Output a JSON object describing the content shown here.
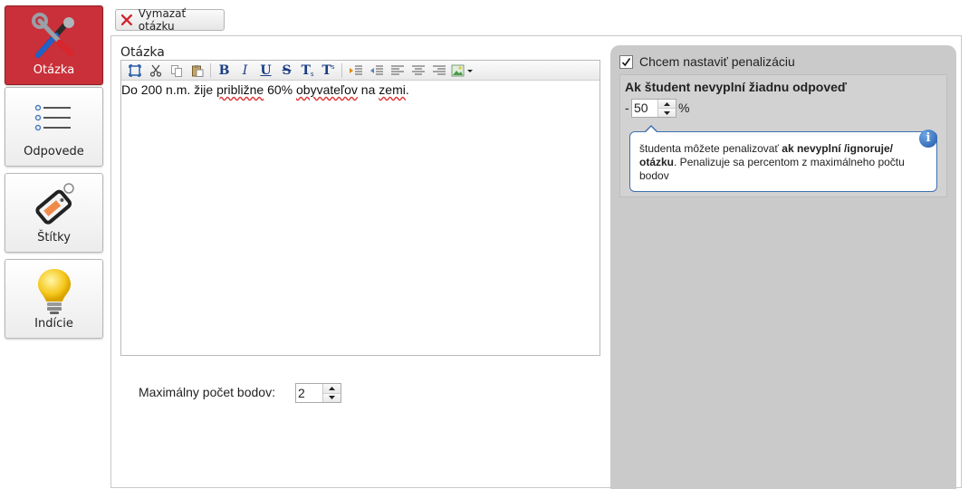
{
  "nav": {
    "items": [
      {
        "label": "Otázka",
        "icon": "tools-icon",
        "active": true
      },
      {
        "label": "Odpovede",
        "icon": "list-icon",
        "active": false
      },
      {
        "label": "Štítky",
        "icon": "tag-icon",
        "active": false
      },
      {
        "label": "Indície",
        "icon": "lightbulb-icon",
        "active": false
      }
    ]
  },
  "toolbar": {
    "delete_label": "Vymazať otázku"
  },
  "question": {
    "label": "Otázka",
    "text_parts": [
      "Do 200 n.m. žije ",
      "približne",
      " 60% ",
      "obyvateľov",
      " na ",
      "zemi",
      "."
    ]
  },
  "editor_toolbar": {
    "buttons": [
      "maximize-icon",
      "cut-icon",
      "copy-icon",
      "paste-icon",
      "bold-icon",
      "italic-icon",
      "underline-icon",
      "strikethrough-icon",
      "subscript-icon",
      "superscript-icon",
      "indent-icon",
      "outdent-icon",
      "align-left-icon",
      "align-center-icon",
      "align-right-icon",
      "image-icon"
    ],
    "bold": "B",
    "italic": "I",
    "underline": "U",
    "strike": "S",
    "subscript": "T",
    "superscript": "T"
  },
  "points": {
    "label": "Maximálny počet bodov:",
    "value": "2"
  },
  "penalty": {
    "checkbox_label": "Chcem nastaviť penalizáciu",
    "checked": true,
    "title": "Ak študent nevyplní žiadnu odpoveď",
    "minus": "-",
    "value": "50",
    "unit": "%",
    "info_prefix": "študenta môžete penalizovať ",
    "info_bold": "ak nevyplní /ignoruje/ otázku",
    "info_suffix": ". Penalizuje sa percentom z maximálneho počtu bodov",
    "info_icon_glyph": "i"
  },
  "colors": {
    "active_tile": "#c9303a",
    "info_border": "#3f6fb0",
    "right_panel": "#cacaca"
  }
}
